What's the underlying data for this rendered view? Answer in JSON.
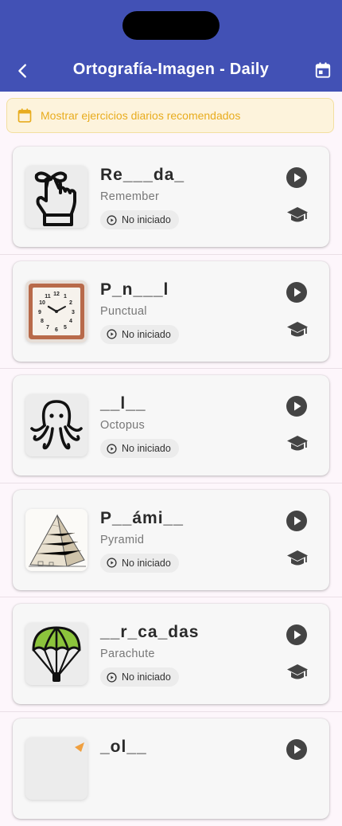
{
  "header": {
    "title": "Ortografía-Imagen - Daily",
    "back_icon": "chevron-left-icon",
    "calendar_icon": "calendar-icon",
    "color": "#4251b5"
  },
  "banner": {
    "text": "Mostrar ejercicios diarios recomendados",
    "icon": "calendar-icon",
    "color": "#e8ac1e"
  },
  "items": [
    {
      "word": "Re___da_",
      "translation": "Remember",
      "status": "No iniciado",
      "icon": "finger-bow-icon"
    },
    {
      "word": "P_n___l",
      "translation": "Punctual",
      "status": "No iniciado",
      "icon": "clock-icon"
    },
    {
      "word": "__l__",
      "translation": "Octopus",
      "status": "No iniciado",
      "icon": "octopus-icon"
    },
    {
      "word": "P__ámi__",
      "translation": "Pyramid",
      "status": "No iniciado",
      "icon": "pyramid-icon"
    },
    {
      "word": "__r_ca_das",
      "translation": "Parachute",
      "status": "No iniciado",
      "icon": "parachute-icon"
    },
    {
      "word": "_ol__",
      "translation": "",
      "status": "",
      "icon": "partial-item-icon"
    }
  ]
}
